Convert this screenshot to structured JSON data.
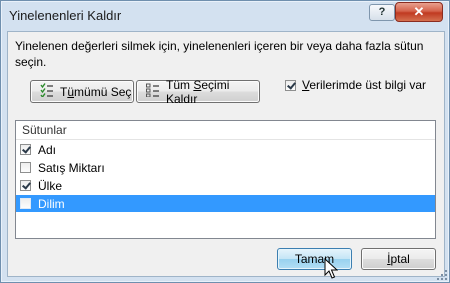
{
  "window": {
    "title": "Yinelenenleri Kaldır",
    "help": "?",
    "close": "✕"
  },
  "description": "Yinelenen değerleri silmek için, yinelenenleri içeren bir veya daha fazla sütun seçin.",
  "buttons": {
    "select_all_pre": "T",
    "select_all_ul": "ü",
    "select_all_post": "mümü Seç",
    "unselect_pre": "Tüm ",
    "unselect_ul": "S",
    "unselect_post": "eçimi Kaldır",
    "ok": "Tamam",
    "cancel_ul": "İ",
    "cancel_post": "ptal"
  },
  "header_option": {
    "ul": "V",
    "rest": "erilerimde üst bilgi var",
    "checked": true
  },
  "columns": {
    "header": "Sütunlar",
    "items": [
      {
        "label": "Adı",
        "checked": true,
        "selected": false
      },
      {
        "label": "Satış Miktarı",
        "checked": false,
        "selected": false
      },
      {
        "label": "Ülke",
        "checked": true,
        "selected": false
      },
      {
        "label": "Dilim",
        "checked": false,
        "selected": true
      }
    ]
  }
}
